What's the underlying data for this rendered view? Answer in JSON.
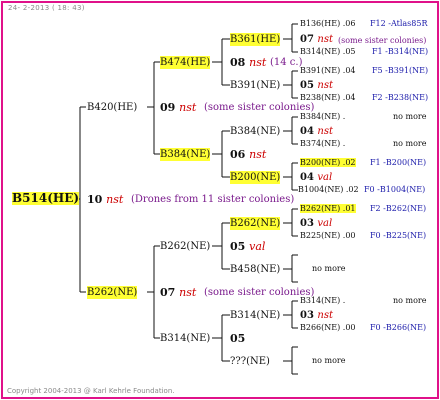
{
  "date": "24- 2-2013 ( 18: 43)",
  "copyright": "Copyright 2004-2013 @ Karl Kehrle Foundation.",
  "root": {
    "label": "B514(HE)",
    "gen": "10",
    "queen": "nst",
    "note": "(Drones from 11 sister colonies)"
  },
  "sire": {
    "label": "B420(HE)",
    "gen": "09",
    "queen": "nst",
    "note": "(some sister colonies)",
    "ss": {
      "label": "B474(HE)",
      "gen": "08",
      "queen": "nst",
      "note": "(14 c.)",
      "sss": {
        "label": "B361(HE)",
        "gen": "07",
        "queen": "nst",
        "note": "(some sister colonies)"
      },
      "ssd": {
        "label": "B391(NE)",
        "gen": "05",
        "queen": "nst"
      }
    },
    "sd": {
      "label": "B384(NE)",
      "gen": "06",
      "queen": "nst",
      "sds": {
        "label": "B384(NE)",
        "gen": "04",
        "queen": "nst"
      },
      "sdd": {
        "label": "B200(NE)",
        "gen": "04",
        "queen": "val"
      }
    }
  },
  "dam": {
    "label": "B262(NE)",
    "gen": "07",
    "queen": "nst",
    "note": "(some sister colonies)",
    "ds": {
      "label": "B262(NE)",
      "gen": "05",
      "queen": "val",
      "dss": {
        "label": "B262(NE)",
        "gen": "03",
        "queen": "val"
      },
      "dsd": {
        "label": "B458(NE)"
      }
    },
    "dd": {
      "label": "B314(NE)",
      "gen": "05",
      "dds": {
        "label": "B314(NE)",
        "gen": "03",
        "queen": "nst"
      },
      "ddd": {
        "label": "???(NE)"
      }
    }
  },
  "ancestors": [
    {
      "name": "B136(HE)",
      "gen": ".06",
      "code": "F12 -Atlas85R",
      "hl": false
    },
    {
      "name": "B314(NE)",
      "gen": ".05",
      "code": "F1 -B314(NE)",
      "hl": false
    },
    {
      "name": "B391(NE)",
      "gen": ".04",
      "code": "F5 -B391(NE)",
      "hl": false
    },
    {
      "name": "B238(NE)",
      "gen": ".04",
      "code": "F2 -B238(NE)",
      "hl": false
    },
    {
      "name": "B384(NE)",
      "gen": ".",
      "code": "no more",
      "hl": false
    },
    {
      "name": "B374(NE)",
      "gen": ".",
      "code": "no more",
      "hl": false
    },
    {
      "name": "B200(NE)",
      "gen": ".02",
      "code": "F1 -B200(NE)",
      "hl": true
    },
    {
      "name": "B1004(NE)",
      "gen": ".02",
      "code": "F0 -B1004(NE)",
      "hl": false
    },
    {
      "name": "B262(NE)",
      "gen": ".01",
      "code": "F2 -B262(NE)",
      "hl": true
    },
    {
      "name": "B225(NE)",
      "gen": ".00",
      "code": "F0 -B225(NE)",
      "hl": false
    },
    {
      "name": "B314(NE)",
      "gen": ".",
      "code": "no more",
      "hl": false
    },
    {
      "name": "B266(NE)",
      "gen": ".00",
      "code": "F0 -B266(NE)",
      "hl": false
    }
  ],
  "no_more": "no more"
}
